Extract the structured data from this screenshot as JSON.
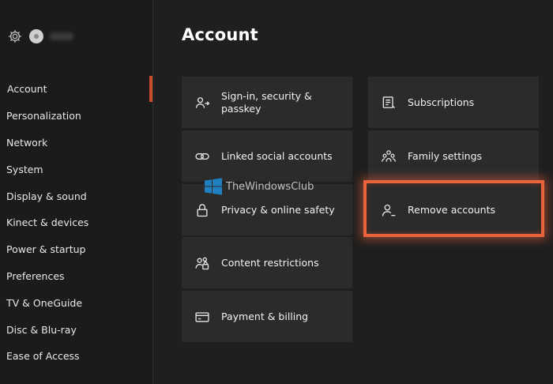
{
  "sidebar": {
    "items": [
      {
        "label": "Account",
        "active": true
      },
      {
        "label": "Personalization"
      },
      {
        "label": "Network"
      },
      {
        "label": "System"
      },
      {
        "label": "Display & sound"
      },
      {
        "label": "Kinect & devices"
      },
      {
        "label": "Power & startup"
      },
      {
        "label": "Preferences"
      },
      {
        "label": "TV & OneGuide"
      },
      {
        "label": "Disc & Blu-ray"
      },
      {
        "label": "Ease of Access"
      }
    ]
  },
  "main": {
    "title": "Account",
    "left_tiles": [
      {
        "label": "Sign-in, security & passkey",
        "icon": "sign-in-icon"
      },
      {
        "label": "Linked social accounts",
        "icon": "link-icon"
      },
      {
        "label": "Privacy & online safety",
        "icon": "lock-icon"
      },
      {
        "label": "Content restrictions",
        "icon": "content-restrictions-icon"
      },
      {
        "label": "Payment & billing",
        "icon": "credit-card-icon"
      }
    ],
    "right_tiles": [
      {
        "label": "Subscriptions",
        "icon": "subscriptions-icon"
      },
      {
        "label": "Family settings",
        "icon": "family-icon"
      },
      {
        "label": "Remove accounts",
        "icon": "remove-account-icon"
      }
    ]
  },
  "watermark": {
    "text": "TheWindowsClub"
  },
  "colors": {
    "accent": "#c84d2c",
    "highlight": "#e8633c",
    "tile": "#2b2b2b",
    "background": "#1f1f1f"
  }
}
